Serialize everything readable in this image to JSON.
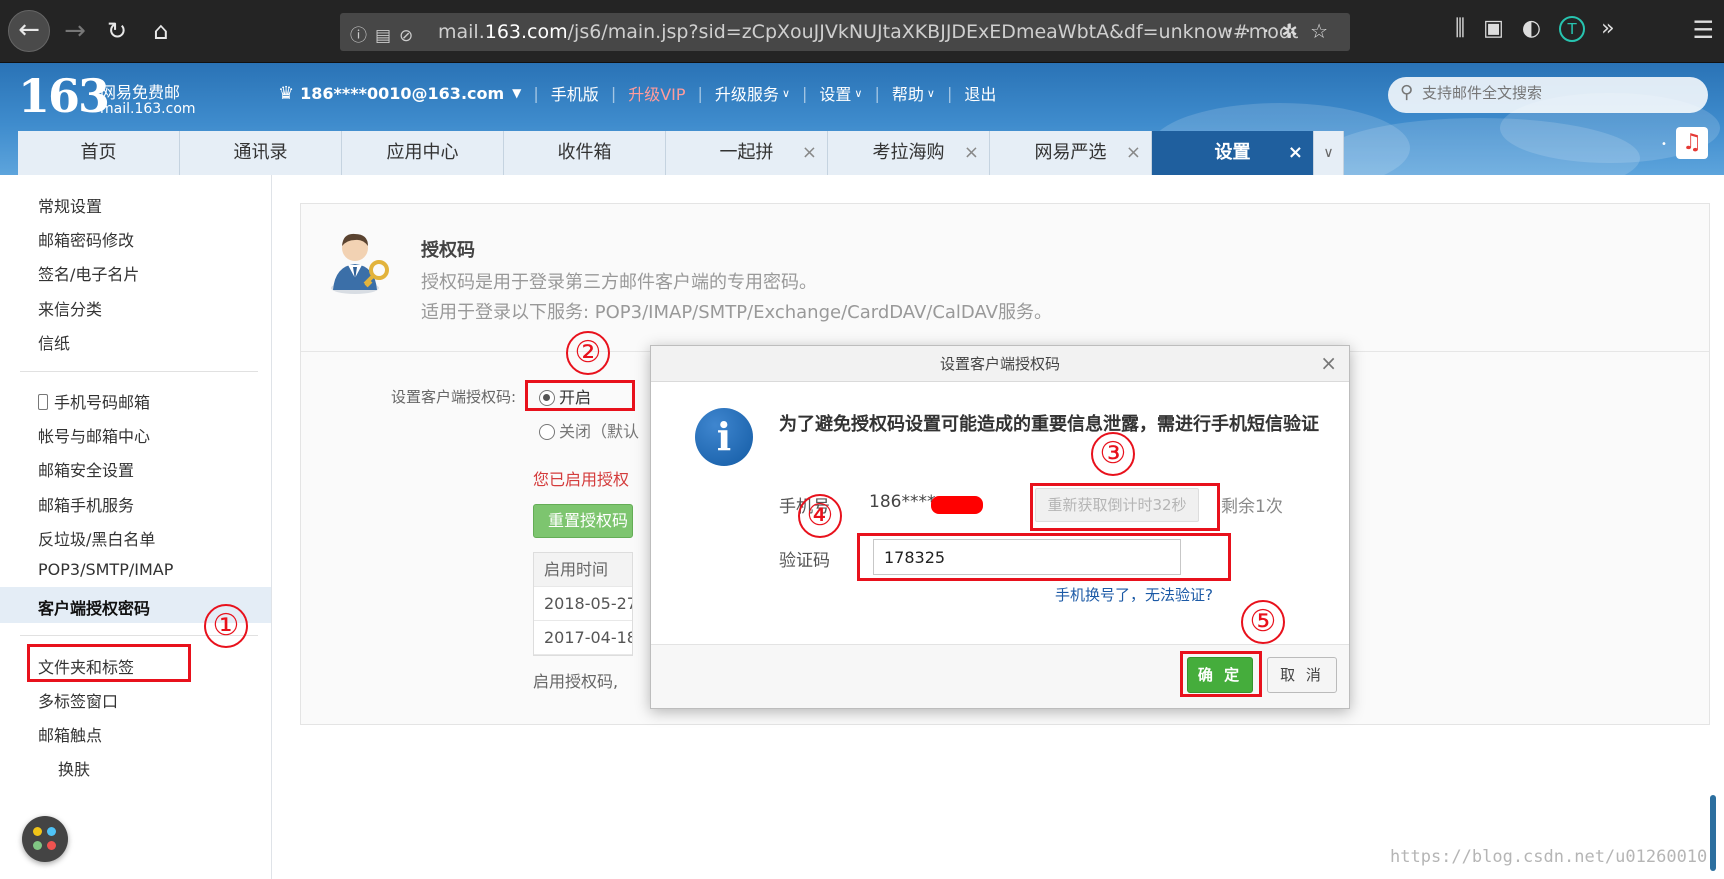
{
  "browser": {
    "url_prefix": "mail.",
    "url_host": "163.com",
    "url_path": "/js6/main.jsp?sid=zCpXouJJVkNUJtaXKBJJDExEDmeaWbtA&df=unknow#module="
  },
  "brand": {
    "logo_number": "163",
    "logo_name": "网易免费邮",
    "logo_url": "mail.163.com"
  },
  "topbar": {
    "account": "186****0010@163.com",
    "links": [
      "手机版",
      "升级VIP",
      "升级服务",
      "设置",
      "帮助",
      "退出"
    ],
    "search_placeholder": "支持邮件全文搜索"
  },
  "tabs": [
    {
      "label": "首页"
    },
    {
      "label": "通讯录"
    },
    {
      "label": "应用中心"
    },
    {
      "label": "收件箱"
    },
    {
      "label": "一起拼"
    },
    {
      "label": "考拉海购"
    },
    {
      "label": "网易严选"
    },
    {
      "label": "设置"
    }
  ],
  "sidebar": {
    "group1": [
      "常规设置",
      "邮箱密码修改",
      "签名/电子名片",
      "来信分类",
      "信纸"
    ],
    "group2": [
      "手机号码邮箱",
      "帐号与邮箱中心",
      "邮箱安全设置",
      "邮箱手机服务",
      "反垃圾/黑白名单",
      "POP3/SMTP/IMAP",
      "客户端授权密码"
    ],
    "group3": [
      "文件夹和标签",
      "多标签窗口",
      "邮箱触点",
      "换肤"
    ]
  },
  "auth": {
    "title": "授权码",
    "desc1": "授权码是用于登录第三方邮件客户端的专用密码。",
    "desc2": "适用于登录以下服务: POP3/IMAP/SMTP/Exchange/CardDAV/CalDAV服务。",
    "form_label": "设置客户端授权码:",
    "option_on": "开启",
    "option_off": "关闭（默认",
    "enabled_note": "您已启用授权",
    "reset_button": "重置授权码",
    "table_header": "启用时间",
    "rows": [
      "2018-05-27",
      "2017-04-18"
    ],
    "bottom_note": "启用授权码,"
  },
  "dialog": {
    "title": "设置客户端授权码",
    "message": "为了避免授权码设置可能造成的重要信息泄露，需进行手机短信验证",
    "phone_label": "手机号",
    "phone_value": "186****",
    "resend_button": "重新获取倒计时32秒",
    "remaining": "剩余1次",
    "code_label": "验证码",
    "code_value": "178325",
    "lost_phone_link": "手机换号了，无法验证?",
    "ok_button": "确 定",
    "cancel_button": "取 消"
  },
  "annotations": [
    "①",
    "②",
    "③",
    "④",
    "⑤"
  ],
  "watermark": "https://blog.csdn.net/u01260010",
  "colors": {
    "annotation_red": "#e8111c",
    "header_blue": "#2a73b6",
    "active_tab": "#1f5f9e",
    "ok_green": "#45ad3c"
  }
}
